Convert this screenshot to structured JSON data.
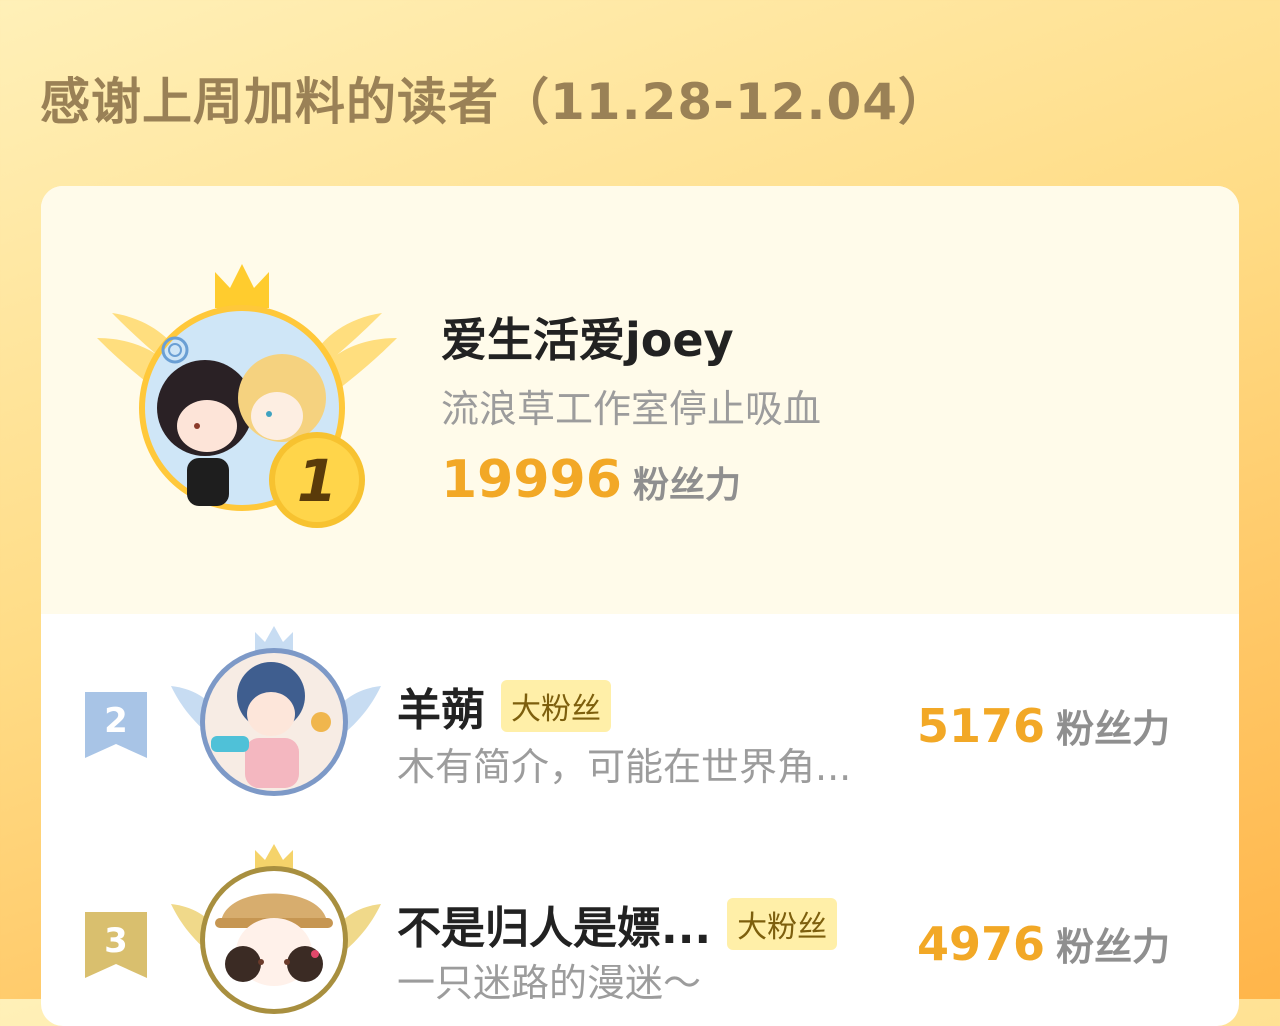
{
  "page": {
    "title": "感谢上周加料的读者（11.28-12.04）"
  },
  "colors": {
    "accent": "#f2a826",
    "title": "#9a8156",
    "badge_bg": "#ffefa8",
    "rank_2": "#a8c4e6",
    "rank_3": "#d9bf6e"
  },
  "readers": [
    {
      "rank": "1",
      "name": "爱生活爱joey",
      "bio": "流浪草工作室停止吸血",
      "score": "19996",
      "unit": "粉丝力",
      "badge": ""
    },
    {
      "rank": "2",
      "name": "羊蒴",
      "bio": "木有简介，可能在世界角...",
      "score": "5176",
      "unit": "粉丝力",
      "badge": "大粉丝"
    },
    {
      "rank": "3",
      "name": "不是归人是嫖...",
      "bio": "一只迷路的漫迷～",
      "score": "4976",
      "unit": "粉丝力",
      "badge": "大粉丝"
    }
  ],
  "icons": [
    "crown-icon",
    "wings-icon",
    "rank-medal-icon",
    "rank-ribbon-icon"
  ]
}
